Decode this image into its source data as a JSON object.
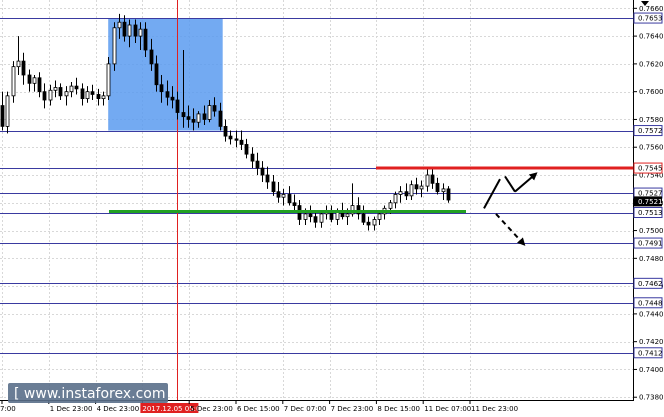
{
  "chart_data": {
    "type": "candlestick",
    "y_ticks": [
      "0.7660",
      "0.7640",
      "0.7620",
      "0.7600",
      "0.7580",
      "0.7560",
      "0.7540",
      "0.7520",
      "0.7500",
      "0.7480",
      "0.7460",
      "0.7440",
      "0.7420",
      "0.7400",
      "0.7380"
    ],
    "ylim": [
      0.7378,
      0.7666
    ],
    "x_ticks": [
      "7:00",
      "1 Dec 23:00",
      "4 Dec 23:00",
      "2017.12.05 05:00",
      "5 Dec 23:00",
      "6 Dec 15:00",
      "7 Dec 07:00",
      "7 Dec 23:00",
      "8 Dec 15:00",
      "11 Dec 07:00",
      "11 Dec 23:00"
    ],
    "highlighted_x_tick": "2017.12.05 05:00",
    "levels": [
      {
        "value": "0.7653",
        "color": "#3a3aa0",
        "highlight": false
      },
      {
        "value": "0.7572",
        "color": "#3a3aa0",
        "highlight": false
      },
      {
        "value": "0.7545",
        "color": "#e02020",
        "highlight": false
      },
      {
        "value": "0.7527",
        "color": "#3a3aa0",
        "highlight": false
      },
      {
        "value": "0.7521",
        "color": "#000000",
        "highlight": true
      },
      {
        "value": "0.7513",
        "color": "#3a3aa0",
        "highlight": false
      },
      {
        "value": "0.7491",
        "color": "#3a3aa0",
        "highlight": false
      },
      {
        "value": "0.7462",
        "color": "#3a3aa0",
        "highlight": false
      },
      {
        "value": "0.7448",
        "color": "#3a3aa0",
        "highlight": false
      },
      {
        "value": "0.7412",
        "color": "#3a3aa0",
        "highlight": false
      }
    ],
    "resistance": {
      "value": 0.7545,
      "color": "#e02020"
    },
    "support": {
      "value": 0.7513,
      "color": "#22a022"
    },
    "zone": {
      "from": 0.7572,
      "to": 0.7653,
      "color": "#5b9bf0"
    },
    "scenario_arrows": [
      {
        "direction": "up",
        "target": 0.7541
      },
      {
        "direction": "down",
        "target": 0.749
      }
    ],
    "ohlc": [
      [
        0.759,
        0.76,
        0.7572,
        0.7575
      ],
      [
        0.7575,
        0.76,
        0.757,
        0.7597
      ],
      [
        0.7597,
        0.7622,
        0.7592,
        0.7618
      ],
      [
        0.7618,
        0.764,
        0.7612,
        0.7622
      ],
      [
        0.7622,
        0.7628,
        0.7605,
        0.7612
      ],
      [
        0.7612,
        0.7616,
        0.76,
        0.7606
      ],
      [
        0.7606,
        0.7612,
        0.76,
        0.761
      ],
      [
        0.761,
        0.7614,
        0.7596,
        0.76
      ],
      [
        0.76,
        0.7606,
        0.7588,
        0.7594
      ],
      [
        0.7594,
        0.7605,
        0.759,
        0.7601
      ],
      [
        0.7601,
        0.7608,
        0.7596,
        0.7603
      ],
      [
        0.7603,
        0.7606,
        0.7594,
        0.7597
      ],
      [
        0.7597,
        0.7604,
        0.759,
        0.76
      ],
      [
        0.76,
        0.7607,
        0.7596,
        0.7604
      ],
      [
        0.7604,
        0.761,
        0.7598,
        0.7602
      ],
      [
        0.7602,
        0.7606,
        0.759,
        0.7595
      ],
      [
        0.7595,
        0.7604,
        0.7592,
        0.76
      ],
      [
        0.76,
        0.7605,
        0.7594,
        0.7598
      ],
      [
        0.7598,
        0.7602,
        0.759,
        0.7595
      ],
      [
        0.7595,
        0.76,
        0.759,
        0.7597
      ],
      [
        0.7597,
        0.7625,
        0.7594,
        0.762
      ],
      [
        0.762,
        0.765,
        0.7615,
        0.7646
      ],
      [
        0.7646,
        0.7656,
        0.7638,
        0.765
      ],
      [
        0.765,
        0.7655,
        0.7636,
        0.764
      ],
      [
        0.764,
        0.7652,
        0.7632,
        0.7648
      ],
      [
        0.7648,
        0.7652,
        0.7635,
        0.764
      ],
      [
        0.764,
        0.765,
        0.763,
        0.7645
      ],
      [
        0.7645,
        0.765,
        0.7625,
        0.763
      ],
      [
        0.763,
        0.7638,
        0.7615,
        0.762
      ],
      [
        0.762,
        0.7626,
        0.76,
        0.7605
      ],
      [
        0.7605,
        0.7612,
        0.7592,
        0.76
      ],
      [
        0.76,
        0.7608,
        0.759,
        0.7596
      ],
      [
        0.7596,
        0.7604,
        0.7588,
        0.7594
      ],
      [
        0.7594,
        0.76,
        0.758,
        0.7585
      ],
      [
        0.7585,
        0.763,
        0.7574,
        0.7582
      ],
      [
        0.7582,
        0.759,
        0.7574,
        0.758
      ],
      [
        0.758,
        0.7588,
        0.7572,
        0.7578
      ],
      [
        0.7578,
        0.7586,
        0.7574,
        0.7584
      ],
      [
        0.7584,
        0.759,
        0.7576,
        0.758
      ],
      [
        0.758,
        0.7594,
        0.7578,
        0.759
      ],
      [
        0.759,
        0.7596,
        0.7582,
        0.7586
      ],
      [
        0.7586,
        0.7592,
        0.7572,
        0.7575
      ],
      [
        0.7575,
        0.758,
        0.7564,
        0.7568
      ],
      [
        0.7568,
        0.7572,
        0.7562,
        0.7566
      ],
      [
        0.7566,
        0.7572,
        0.756,
        0.7565
      ],
      [
        0.7565,
        0.7572,
        0.7558,
        0.7562
      ],
      [
        0.7562,
        0.7566,
        0.7552,
        0.7555
      ],
      [
        0.7555,
        0.756,
        0.7545,
        0.755
      ],
      [
        0.755,
        0.7556,
        0.754,
        0.7545
      ],
      [
        0.7545,
        0.755,
        0.7535,
        0.754
      ],
      [
        0.754,
        0.7546,
        0.753,
        0.7535
      ],
      [
        0.7535,
        0.754,
        0.7525,
        0.7528
      ],
      [
        0.7528,
        0.7535,
        0.752,
        0.7524
      ],
      [
        0.7524,
        0.753,
        0.7518,
        0.7526
      ],
      [
        0.7526,
        0.7532,
        0.7518,
        0.752
      ],
      [
        0.752,
        0.7526,
        0.7514,
        0.7518
      ],
      [
        0.7518,
        0.7522,
        0.7504,
        0.7508
      ],
      [
        0.7508,
        0.7516,
        0.7504,
        0.7512
      ],
      [
        0.7512,
        0.7518,
        0.7506,
        0.751
      ],
      [
        0.751,
        0.7514,
        0.7502,
        0.7506
      ],
      [
        0.7506,
        0.7514,
        0.7502,
        0.7512
      ],
      [
        0.7512,
        0.7518,
        0.7508,
        0.7514
      ],
      [
        0.7514,
        0.7518,
        0.7506,
        0.7508
      ],
      [
        0.7508,
        0.7516,
        0.7504,
        0.7514
      ],
      [
        0.7514,
        0.752,
        0.7508,
        0.751
      ],
      [
        0.751,
        0.7516,
        0.7504,
        0.7512
      ],
      [
        0.7512,
        0.7534,
        0.751,
        0.7518
      ],
      [
        0.7518,
        0.7524,
        0.7508,
        0.7512
      ],
      [
        0.7512,
        0.7518,
        0.7504,
        0.7506
      ],
      [
        0.7506,
        0.751,
        0.75,
        0.7504
      ],
      [
        0.7504,
        0.751,
        0.75,
        0.7508
      ],
      [
        0.7508,
        0.7514,
        0.7504,
        0.7512
      ],
      [
        0.7512,
        0.7518,
        0.7508,
        0.7516
      ],
      [
        0.7516,
        0.7522,
        0.7512,
        0.752
      ],
      [
        0.752,
        0.7528,
        0.7516,
        0.7526
      ],
      [
        0.7526,
        0.7532,
        0.752,
        0.7528
      ],
      [
        0.7528,
        0.7534,
        0.7522,
        0.7525
      ],
      [
        0.7525,
        0.7536,
        0.7522,
        0.7533
      ],
      [
        0.7533,
        0.7538,
        0.7526,
        0.753
      ],
      [
        0.753,
        0.7536,
        0.7524,
        0.7532
      ],
      [
        0.7532,
        0.7546,
        0.7528,
        0.754
      ],
      [
        0.754,
        0.7544,
        0.753,
        0.7534
      ],
      [
        0.7534,
        0.7538,
        0.7526,
        0.7528
      ],
      [
        0.7528,
        0.7534,
        0.7522,
        0.753
      ],
      [
        0.753,
        0.7532,
        0.752,
        0.7522
      ]
    ]
  },
  "watermark": {
    "text": "[ www.instaforex.com ]"
  }
}
